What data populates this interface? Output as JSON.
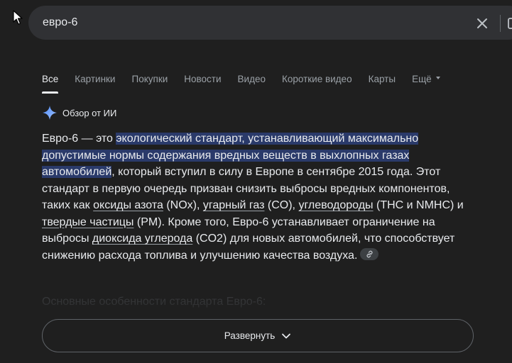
{
  "search": {
    "query": "евро-6"
  },
  "tabs": [
    {
      "label": "Все",
      "active": true
    },
    {
      "label": "Картинки"
    },
    {
      "label": "Покупки"
    },
    {
      "label": "Новости"
    },
    {
      "label": "Видео"
    },
    {
      "label": "Короткие видео"
    },
    {
      "label": "Карты"
    },
    {
      "label": "Ещё"
    }
  ],
  "ai_overview": {
    "title": "Обзор от ИИ",
    "p1": "Евро-6 — это ",
    "highlight": "экологический стандарт, устанавливающий максимально допустимые нормы содержания вредных веществ в выхлопных газах автомобилей",
    "p2": ", который вступил в силу в Европе в сентябре 2015 года. Этот стандарт в первую очередь призван снизить выбросы вредных компонентов, таких как ",
    "link1": "оксиды азота",
    "p3": " (NOx), ",
    "link2": "угарный газ",
    "p4": " (CO), ",
    "link3": "углеводороды",
    "p5": " (THC и NMHC) и ",
    "link4": "твердые частицы",
    "p6": " (PM). Кроме того, Евро-6 устанавливает ограничение на выбросы ",
    "link5": "диоксида углерода",
    "p7": " (CO2) для новых автомобилей, что способствует снижению расхода топлива и улучшению качества воздуха.",
    "subheading": "Основные особенности стандарта Евро-6:",
    "expand_label": "Развернуть"
  },
  "colors": {
    "background": "#1f1f1f",
    "searchbar": "#303134",
    "highlight": "#2a3a6a"
  }
}
